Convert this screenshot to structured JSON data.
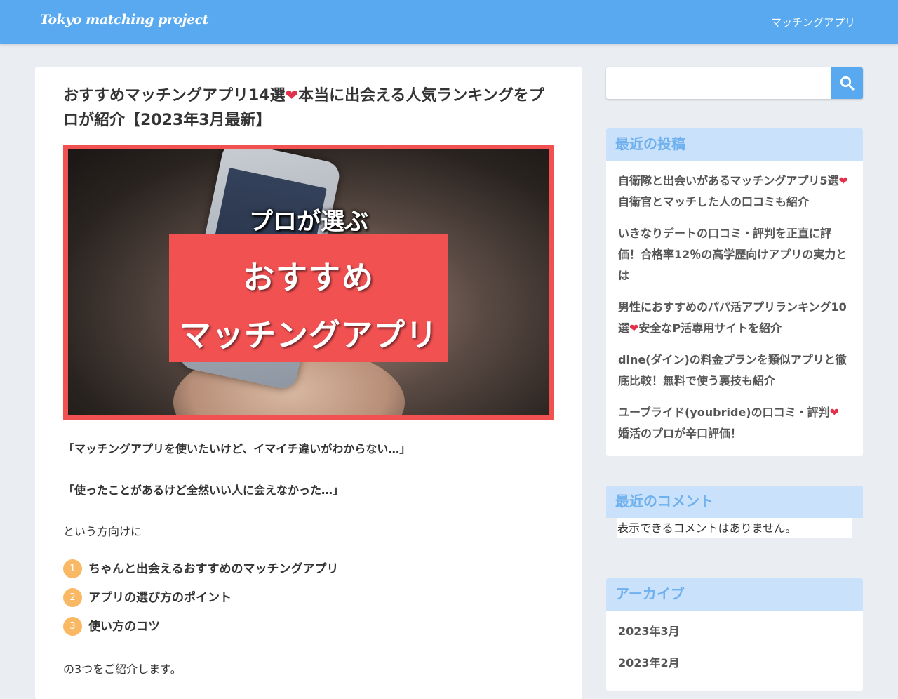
{
  "header": {
    "site_title": "Tokyo matching project",
    "nav_link": "マッチングアプリ"
  },
  "article": {
    "title_part1": "おすすめマッチングアプリ14選",
    "title_heart": "❤",
    "title_part2": "本当に出会える人気ランキングをプロが紹介【2023年3月最新】",
    "hero": {
      "subtitle": "プロが選ぶ",
      "line1": "おすすめ",
      "line2": "マッチングアプリ"
    },
    "quote1": "「マッチングアプリを使いたいけど、イマイチ違いがわからない…」",
    "quote2": "「使ったことがあるけど全然いい人に会えなかった…」",
    "intro": "という方向けに",
    "list": [
      {
        "num": "1",
        "text": "ちゃんと出会えるおすすめのマッチングアプリ"
      },
      {
        "num": "2",
        "text": "アプリの選び方のポイント"
      },
      {
        "num": "3",
        "text": "使い方のコツ"
      }
    ],
    "outro": "の3つをご紹介します。"
  },
  "sidebar": {
    "search": {
      "placeholder": ""
    },
    "recent_posts": {
      "title": "最近の投稿",
      "items": [
        {
          "before": "自衛隊と出会いがあるマッチングアプリ5選",
          "heart": "❤",
          "after": "自衛官とマッチした人の口コミも紹介"
        },
        {
          "before": "いきなりデートの口コミ・評判を正直に評価！合格率12％の高学歴向けアプリの実力とは",
          "heart": "",
          "after": ""
        },
        {
          "before": "男性におすすめのパパ活アプリランキング10選",
          "heart": "❤",
          "after": "安全なP活専用サイトを紹介"
        },
        {
          "before": "dine(ダイン)の料金プランを類似アプリと徹底比較！無料で使う裏技も紹介",
          "heart": "",
          "after": ""
        },
        {
          "before": "ユーブライド(youbride)の口コミ・評判",
          "heart": "❤",
          "after": "婚活のプロが辛口評価！"
        }
      ]
    },
    "recent_comments": {
      "title": "最近のコメント",
      "empty_text": "表示できるコメントはありません。"
    },
    "archive": {
      "title": "アーカイブ",
      "items": [
        "2023年3月",
        "2023年2月"
      ]
    }
  },
  "colors": {
    "header_bg": "#58a9ef",
    "hero_red": "#f25152",
    "widget_title_bg": "#c9e1fb",
    "widget_title_text": "#6fb0ee",
    "list_badge": "#f9b864",
    "heart": "#e2314b"
  }
}
